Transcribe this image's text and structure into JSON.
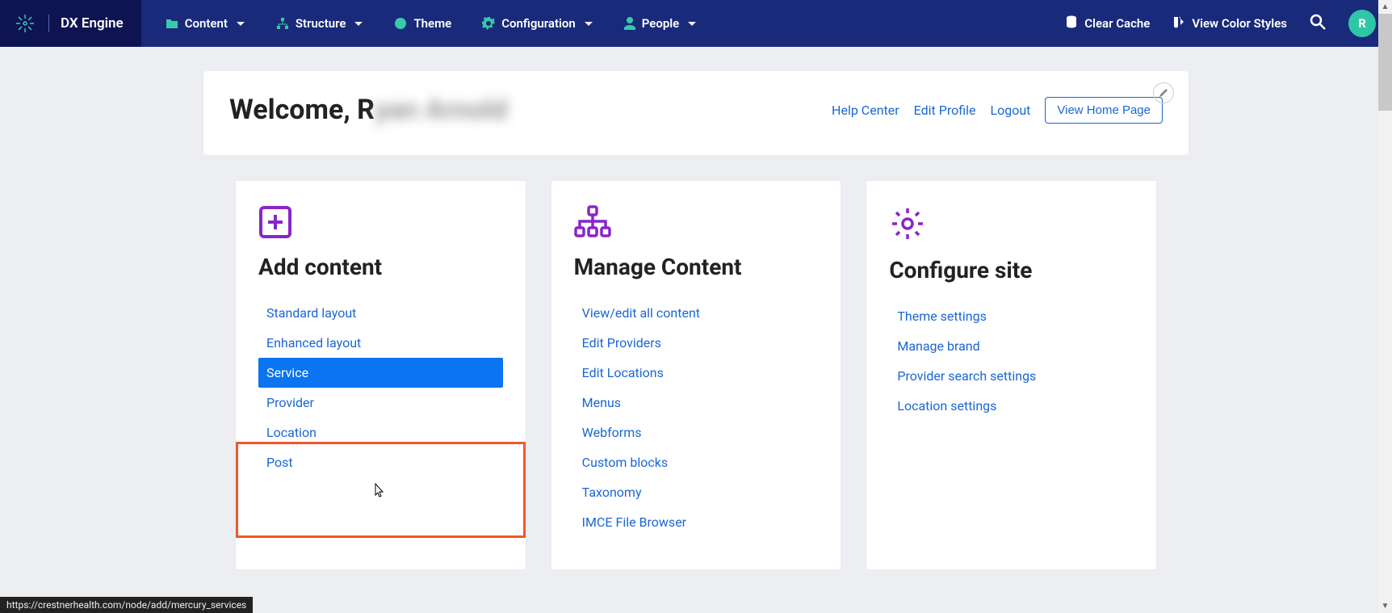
{
  "brand": {
    "name": "DX Engine"
  },
  "nav": [
    {
      "label": "Content",
      "has_chevron": true
    },
    {
      "label": "Structure",
      "has_chevron": true
    },
    {
      "label": "Theme",
      "has_chevron": false
    },
    {
      "label": "Configuration",
      "has_chevron": true
    },
    {
      "label": "People",
      "has_chevron": true
    }
  ],
  "topbar_right": {
    "clear_cache": "Clear Cache",
    "view_styles": "View Color Styles",
    "avatar_letter": "R"
  },
  "welcome": {
    "prefix": "Welcome, R",
    "blurred": "yan Arnold",
    "links": {
      "help": "Help Center",
      "edit_profile": "Edit Profile",
      "logout": "Logout",
      "home_btn": "View Home Page"
    }
  },
  "cards": {
    "add": {
      "title": "Add content",
      "items": [
        "Standard layout",
        "Enhanced layout",
        "Service",
        "Provider",
        "Location",
        "Post"
      ],
      "active_index": 2
    },
    "manage": {
      "title": "Manage Content",
      "items": [
        "View/edit all content",
        "Edit Providers",
        "Edit Locations",
        "Menus",
        "Webforms",
        "Custom blocks",
        "Taxonomy",
        "IMCE File Browser"
      ]
    },
    "configure": {
      "title": "Configure site",
      "items": [
        "Theme settings",
        "Manage brand",
        "Provider search settings",
        "Location settings"
      ]
    }
  },
  "status_url": "https://crestnerhealth.com/node/add/mercury_services"
}
